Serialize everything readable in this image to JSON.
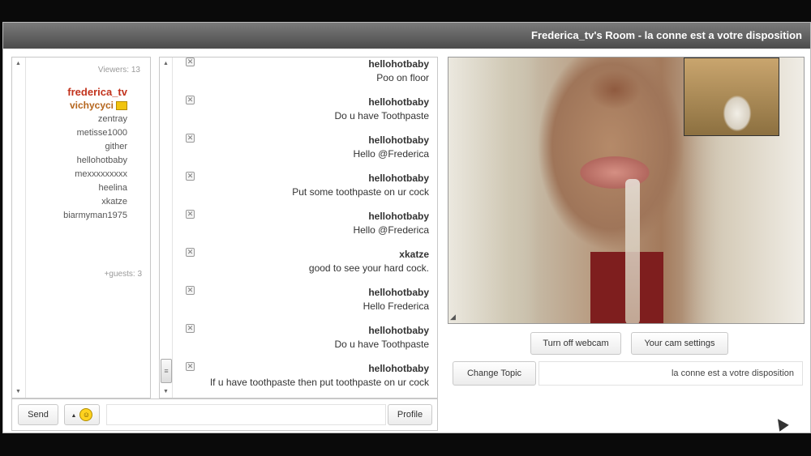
{
  "window": {
    "title": "Frederica_tv's Room - la conne est a votre disposition"
  },
  "users": {
    "viewers_label": "Viewers: 13",
    "owner": "frederica_tv",
    "moderator": "vichycyci",
    "list": [
      "zentray",
      "metisse1000",
      "gither",
      "hellohotbaby",
      "mexxxxxxxxx",
      "heelina",
      "xkatze",
      "biarmyman1975"
    ],
    "guests_label": "+guests: 3"
  },
  "chat": {
    "messages": [
      {
        "user": "hellohotbaby",
        "text": "Poo on floor"
      },
      {
        "user": "hellohotbaby",
        "text": "Do u have Toothpaste"
      },
      {
        "user": "hellohotbaby",
        "text": "Hello @Frederica"
      },
      {
        "user": "hellohotbaby",
        "text": "Put some toothpaste on ur cock"
      },
      {
        "user": "hellohotbaby",
        "text": "Hello @Frederica"
      },
      {
        "user": "xkatze",
        "text": "good to see your hard cock."
      },
      {
        "user": "hellohotbaby",
        "text": "Hello Frederica"
      },
      {
        "user": "hellohotbaby",
        "text": "Do u have Toothpaste"
      },
      {
        "user": "hellohotbaby",
        "text": "If u have toothpaste then put toothpaste on ur cock"
      }
    ],
    "delete_glyph": "✕"
  },
  "toolbar": {
    "send_label": "Send",
    "emoji_glyph": "☺",
    "profile_label": "Profile"
  },
  "webcam": {
    "cam_settings_label": "Your cam settings",
    "turn_off_label": "Turn off webcam"
  },
  "topic": {
    "value": "la conne est a votre disposition",
    "change_label": "Change Topic"
  },
  "icons": {
    "scroll_up": "▲",
    "scroll_down": "▼",
    "thumb": "≡",
    "caret": "▲",
    "grip": "◢"
  },
  "colors": {
    "owner": "#c2331d",
    "moderator": "#b5651d",
    "titlebar": "#5a5a5a"
  }
}
